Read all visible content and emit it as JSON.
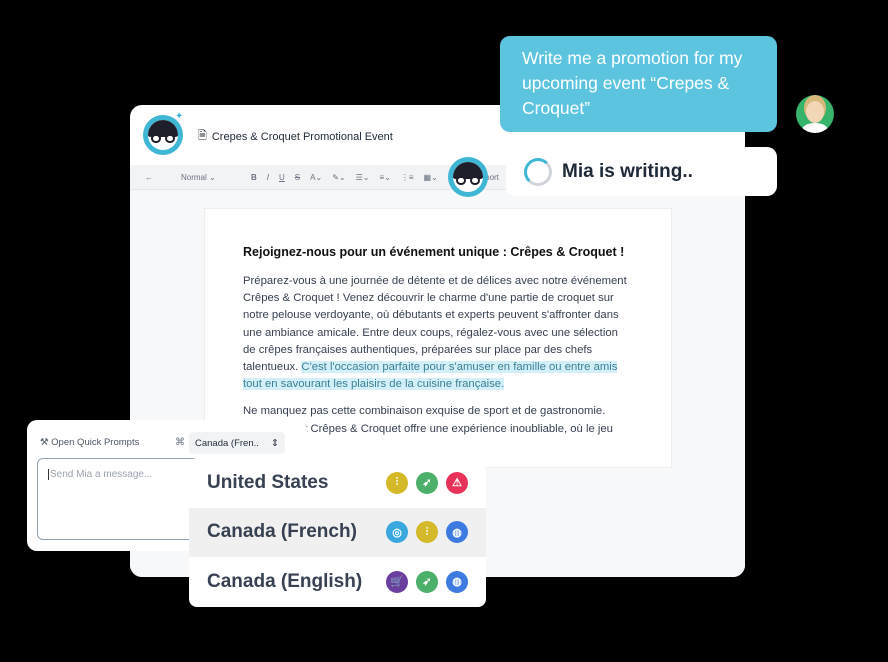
{
  "document": {
    "title": "Crepes & Croquet Promotional Event",
    "heading": "Rejoignez-nous pour un événement unique : Crêpes & Croquet !",
    "paragraph": "Préparez-vous à une journée de détente et de délices avec notre événement Crêpes & Croquet ! Venez découvrir le charme d'une partie de croquet sur notre pelouse verdoyante, où débutants et experts peuvent s'affronter dans une ambiance amicale. Entre deux coups, régalez-vous avec une sélection de crêpes françaises authentiques, préparées sur place par des chefs talentueux. ",
    "highlight": "C'est l'occasion parfaite pour s'amuser en famille ou entre amis tout en savourant les plaisirs de la cuisine française.",
    "faded": "Ne manquez pas cette combinaison exquise de sport et de gastronomie. L'événement Crêpes & Croquet offre une expérience inoubliable, où le jeu"
  },
  "toolbar": {
    "style": "Normal",
    "export": "Export"
  },
  "chat": {
    "user_message": "Write me a promotion for my upcoming event “Crepes & Croquet”",
    "status": "Mia is writing.."
  },
  "prompt": {
    "quick_prompts": "Open Quick Prompts",
    "locale": "Canada (Fren..",
    "placeholder": "Send Mia a message..."
  },
  "dropdown": {
    "options": [
      {
        "label": "United States",
        "icons": [
          [
            "#d4b92b",
            "waveform-icon"
          ],
          [
            "#4caf6a",
            "rocket-icon"
          ],
          [
            "#e8325a",
            "siren-icon"
          ]
        ]
      },
      {
        "label": "Canada (French)",
        "selected": true,
        "icons": [
          [
            "#3aa8df",
            "globe-icon"
          ],
          [
            "#d4b92b",
            "waveform-icon"
          ],
          [
            "#3d7be0",
            "fingerprint-icon"
          ]
        ]
      },
      {
        "label": "Canada (English)",
        "icons": [
          [
            "#6a3fa0",
            "cart-icon"
          ],
          [
            "#4caf6a",
            "rocket-icon"
          ],
          [
            "#3d7be0",
            "fingerprint-icon"
          ]
        ]
      }
    ]
  }
}
